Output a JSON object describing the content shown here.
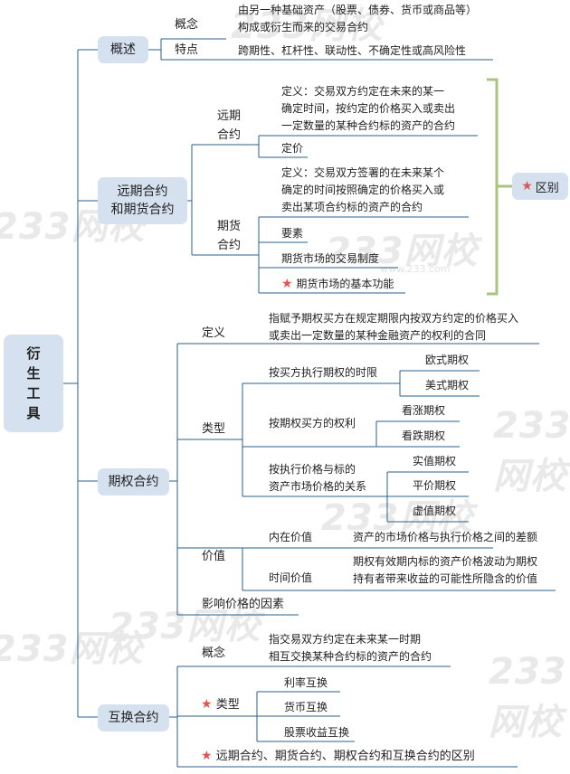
{
  "root": "衍生工具",
  "watermark": {
    "text": "233网校",
    "url": "www.233.com"
  },
  "overview": {
    "label": "概述",
    "concept_label": "概念",
    "concept_text": [
      "由另一种基础资产（股票、债券、货币或商品等）",
      "构成或衍生而来的交易合约"
    ],
    "feature_label": "特点",
    "feature_text": "跨期性、杠杆性、联动性、不确定性或高风险性"
  },
  "forward_futures": {
    "label": [
      "远期合约",
      "和期货合约"
    ],
    "forward": {
      "label": [
        "远期",
        "合约"
      ],
      "definition": [
        "定义：交易双方约定在未来的某一",
        "确定时间，按约定的价格买入或卖出",
        "一定数量的某种合约标的资产的合约"
      ],
      "pricing": "定价"
    },
    "futures": {
      "label": [
        "期货",
        "合约"
      ],
      "definition": [
        "定义：交易双方签署的在未来某个",
        "确定的时间按照确定的价格买入或",
        "卖出某项合约标的资产的合约"
      ],
      "elements": "要素",
      "system": "期货市场的交易制度",
      "function": "期货市场的基本功能"
    },
    "difference": "区别"
  },
  "options": {
    "label": "期权合约",
    "definition_label": "定义",
    "definition_text": [
      "指赋予期权买方在规定期限内按双方约定的价格买入",
      "或卖出一定数量的某种金融资产的权利的合同"
    ],
    "types_label": "类型",
    "by_time": {
      "label": "按买方执行期权的时限",
      "items": [
        "欧式期权",
        "美式期权"
      ]
    },
    "by_right": {
      "label": "按期权买方的权利",
      "items": [
        "看涨期权",
        "看跌期权"
      ]
    },
    "by_price": {
      "label": [
        "按执行价格与标的",
        "资产市场价格的关系"
      ],
      "items": [
        "实值期权",
        "平价期权",
        "虚值期权"
      ]
    },
    "value_label": "价值",
    "intrinsic": {
      "label": "内在价值",
      "text": "资产的市场价格与执行价格之间的差额"
    },
    "time_value": {
      "label": "时间价值",
      "text": [
        "期权有效期内标的资产价格波动为期权",
        "持有者带来收益的可能性所隐含的价值"
      ]
    },
    "factors": "影响价格的因素"
  },
  "swaps": {
    "label": "互换合约",
    "concept_label": "概念",
    "concept_text": [
      "指交易双方约定在未来某一时期",
      "相互交换某种合约标的资产的合约"
    ],
    "types_label": "类型",
    "types": [
      "利率互换",
      "货币互换",
      "股票收益互换"
    ],
    "difference": "远期合约、期货合约、期权合约和互换合约的区别"
  },
  "colors": {
    "node": "#d5e1ee",
    "line": "#2b5f8f",
    "bracket": "#a9c47f",
    "star": "#e55252"
  }
}
